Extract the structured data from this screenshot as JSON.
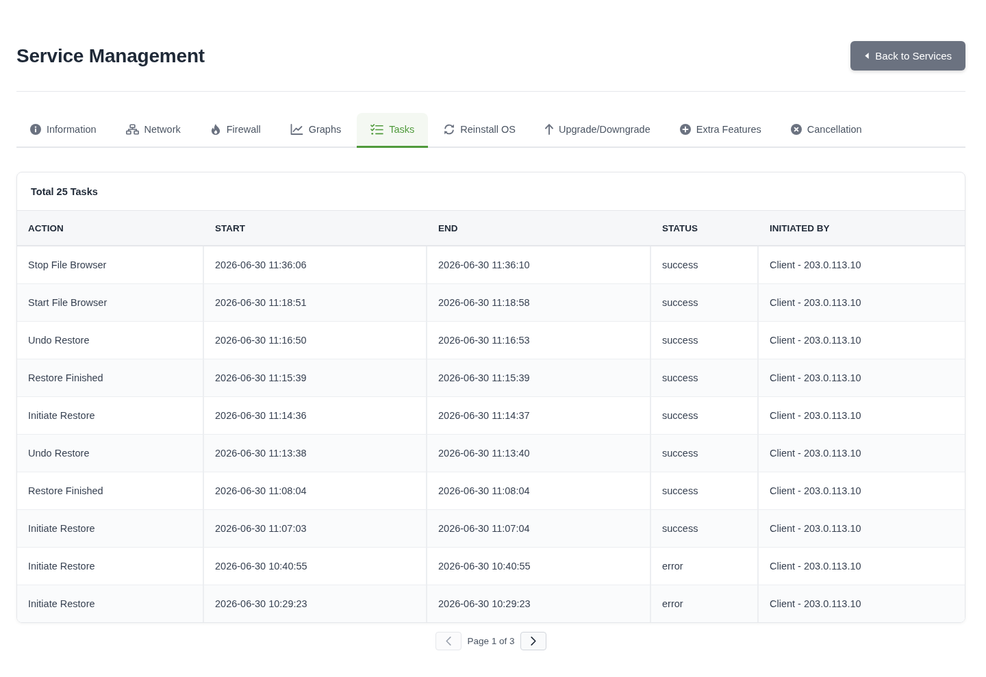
{
  "title": "Service Management",
  "back_button": {
    "label": "Back to Services"
  },
  "tabs": [
    {
      "label": "Information",
      "selected": false
    },
    {
      "label": "Network",
      "selected": false
    },
    {
      "label": "Firewall",
      "selected": false
    },
    {
      "label": "Graphs",
      "selected": false
    },
    {
      "label": "Tasks",
      "selected": true
    },
    {
      "label": "Reinstall OS",
      "selected": false
    },
    {
      "label": "Upgrade/Downgrade",
      "selected": false
    },
    {
      "label": "Extra Features",
      "selected": false
    },
    {
      "label": "Cancellation",
      "selected": false
    }
  ],
  "tasks_card": {
    "title": "Total 25 Tasks",
    "table": {
      "columns": [
        "ACTION",
        "START",
        "END",
        "STATUS",
        "INITIATED BY"
      ],
      "rows": [
        [
          "Stop File Browser",
          "2026-06-30 11:36:06",
          "2026-06-30 11:36:10",
          "success",
          "Client - 203.0.113.10"
        ],
        [
          "Start File Browser",
          "2026-06-30 11:18:51",
          "2026-06-30 11:18:58",
          "success",
          "Client - 203.0.113.10"
        ],
        [
          "Undo Restore",
          "2026-06-30 11:16:50",
          "2026-06-30 11:16:53",
          "success",
          "Client - 203.0.113.10"
        ],
        [
          "Restore Finished",
          "2026-06-30 11:15:39",
          "2026-06-30 11:15:39",
          "success",
          "Client - 203.0.113.10"
        ],
        [
          "Initiate Restore",
          "2026-06-30 11:14:36",
          "2026-06-30 11:14:37",
          "success",
          "Client - 203.0.113.10"
        ],
        [
          "Undo Restore",
          "2026-06-30 11:13:38",
          "2026-06-30 11:13:40",
          "success",
          "Client - 203.0.113.10"
        ],
        [
          "Restore Finished",
          "2026-06-30 11:08:04",
          "2026-06-30 11:08:04",
          "success",
          "Client - 203.0.113.10"
        ],
        [
          "Initiate Restore",
          "2026-06-30 11:07:03",
          "2026-06-30 11:07:04",
          "success",
          "Client - 203.0.113.10"
        ],
        [
          "Initiate Restore",
          "2026-06-30 10:40:55",
          "2026-06-30 10:40:55",
          "error",
          "Client - 203.0.113.10"
        ],
        [
          "Initiate Restore",
          "2026-06-30 10:29:23",
          "2026-06-30 10:29:23",
          "error",
          "Client - 203.0.113.10"
        ]
      ]
    }
  },
  "pagination": {
    "label": "Page 1 of 3",
    "previous": {
      "disabled": true
    },
    "next": {
      "disabled": false
    }
  }
}
